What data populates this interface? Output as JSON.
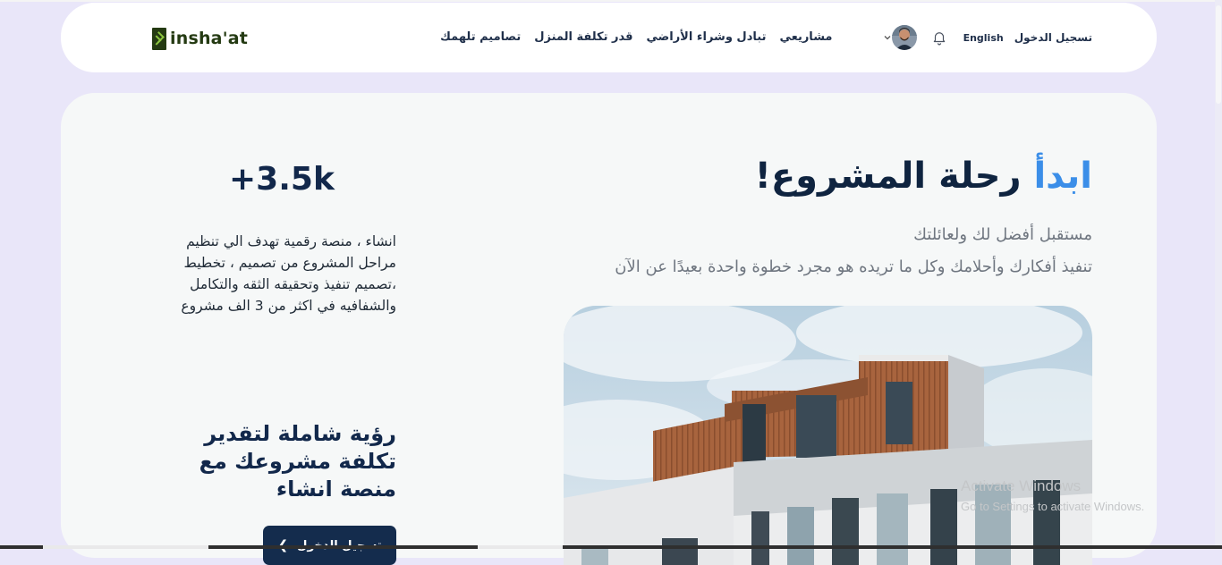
{
  "brand": {
    "logo_text": "insha'at"
  },
  "nav": {
    "links": [
      "مشاريعي",
      "تبادل وشراء الأراضي",
      "قدر تكلفة المنزل",
      "تصاميم تلهمك"
    ],
    "login": "تسجيل الدخول",
    "language": "English"
  },
  "hero": {
    "title_accent": "ابدأ",
    "title_rest": "رحلة المشروع!",
    "subtitle_line1": "مستقبل أفضل لك ولعائلتك",
    "subtitle_line2": "تنفيذ أفكارك وأحلامك وكل ما تريده هو مجرد خطوة واحدة بعيدًا عن الآن"
  },
  "stats": {
    "count": "+3.5k",
    "description": "انشاء ، منصة رقمية تهدف الي تنظيم مراحل المشروع من تصميم ، تخطيط ،تصميم تنفيذ وتحقيقه الثقه والتكامل والشفافيه في اكثر من 3 الف مشروع"
  },
  "vision": {
    "heading": "رؤية شاملة لتقدير تكلفة مشروعك مع منصة انشاء",
    "button_label": "تسجيل الدخول"
  },
  "watermark": {
    "line1": "Activate Windows",
    "line2": "Go to Settings to activate Windows."
  },
  "colors": {
    "page_bg": "#e9e6f9",
    "navy": "#12284b",
    "accent_blue": "#3b8ee8",
    "logo_green": "#243a12"
  },
  "icons": [
    "logo-mark-icon",
    "bell-icon",
    "avatar",
    "chevron-down-icon",
    "arrow-left-icon"
  ]
}
